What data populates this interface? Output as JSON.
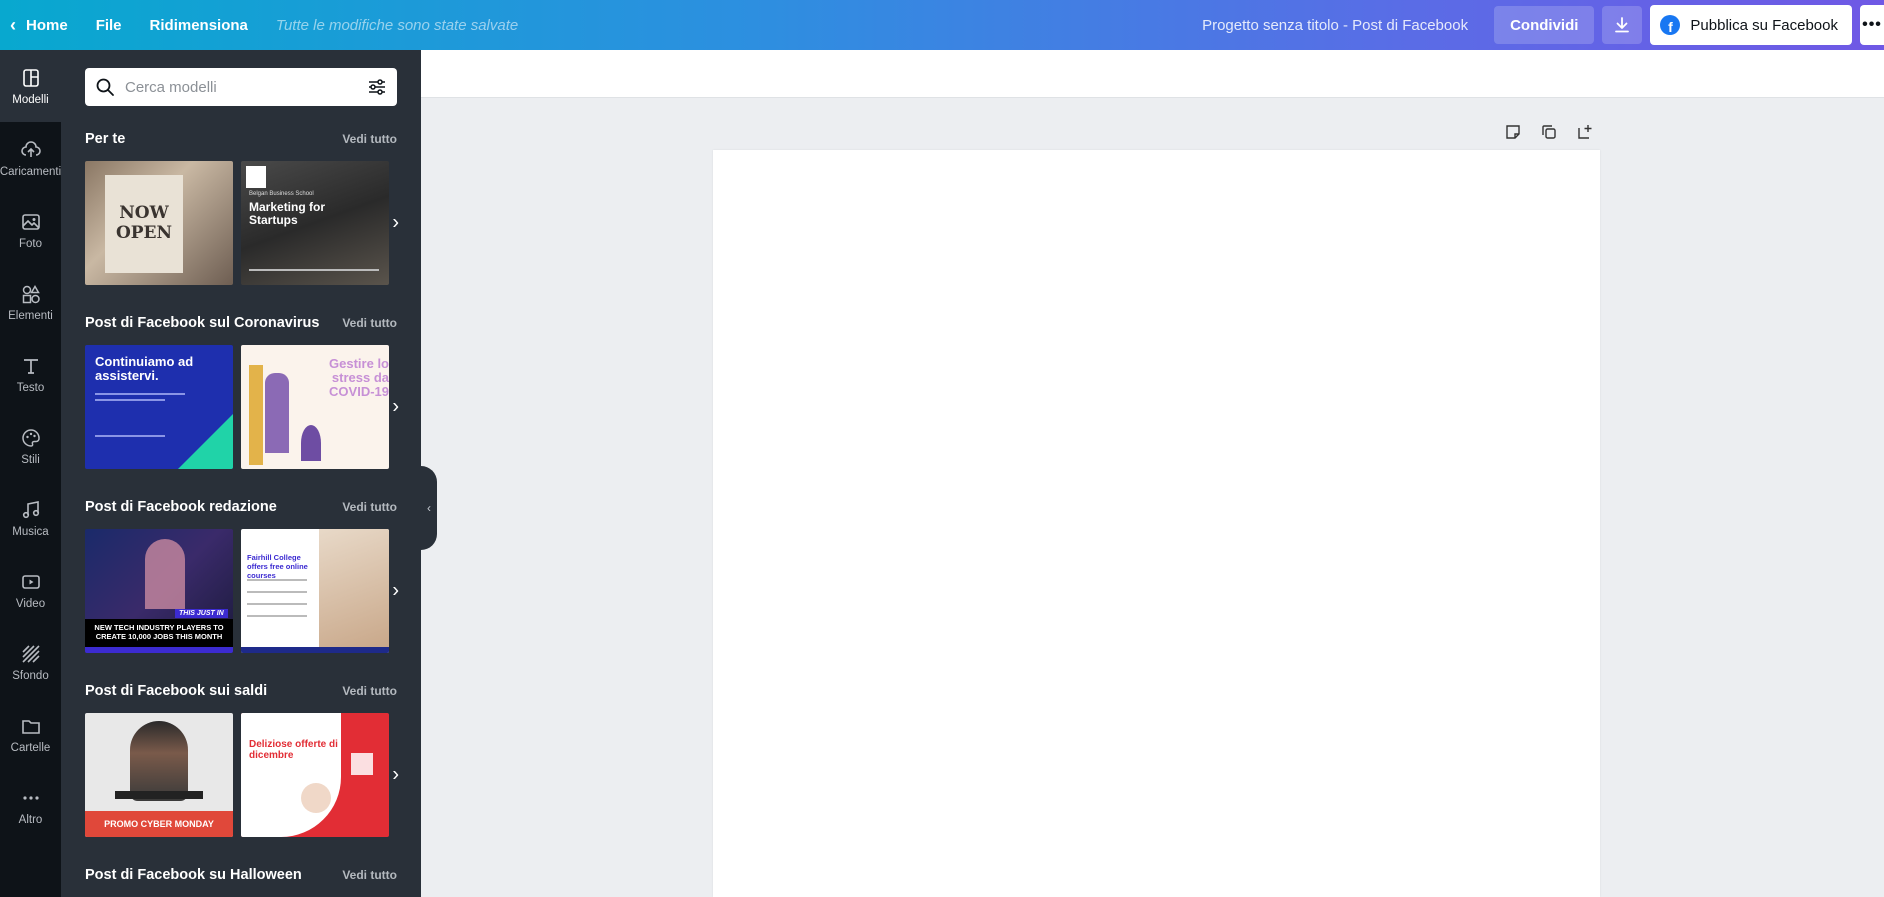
{
  "topbar": {
    "home": "Home",
    "file": "File",
    "resize": "Ridimensiona",
    "saved": "Tutte le modifiche sono state salvate",
    "project_title": "Progetto senza titolo - Post di Facebook",
    "share": "Condividi",
    "publish": "Pubblica su Facebook",
    "more": "•••"
  },
  "rail": {
    "items": [
      {
        "label": "Modelli",
        "icon": "templates-icon"
      },
      {
        "label": "Caricamenti",
        "icon": "upload-icon"
      },
      {
        "label": "Foto",
        "icon": "photo-icon"
      },
      {
        "label": "Elementi",
        "icon": "elements-icon"
      },
      {
        "label": "Testo",
        "icon": "text-icon"
      },
      {
        "label": "Stili",
        "icon": "styles-icon"
      },
      {
        "label": "Musica",
        "icon": "music-icon"
      },
      {
        "label": "Video",
        "icon": "video-icon"
      },
      {
        "label": "Sfondo",
        "icon": "background-icon"
      },
      {
        "label": "Cartelle",
        "icon": "folder-icon"
      },
      {
        "label": "Altro",
        "icon": "more-icon"
      }
    ]
  },
  "panel": {
    "search_placeholder": "Cerca modelli",
    "see_all": "Vedi tutto",
    "sections": [
      {
        "title": "Per te"
      },
      {
        "title": "Post di Facebook sul Coronavirus"
      },
      {
        "title": "Post di Facebook redazione"
      },
      {
        "title": "Post di Facebook sui saldi"
      },
      {
        "title": "Post di Facebook su Halloween"
      }
    ],
    "thumbs": {
      "now_open": "NOW OPEN",
      "school": "Belgan Business School",
      "marketing": "Marketing for Startups",
      "continuiamo": "Continuiamo ad assistervi.",
      "covid": "Gestire lo stress da COVID-19",
      "tech": "NEW TECH INDUSTRY PLAYERS TO CREATE 10,000 JOBS THIS MONTH",
      "just_in": "THIS JUST IN",
      "fairhill": "Fairhill College offers free online courses",
      "cyber": "PROMO CYBER MONDAY",
      "dicembre": "Deliziose offerte di dicembre"
    }
  },
  "colors": {
    "topbar_start": "#08a8cf",
    "topbar_end": "#6f58e5",
    "rail_bg": "#0e1318",
    "panel_bg": "#293039"
  }
}
